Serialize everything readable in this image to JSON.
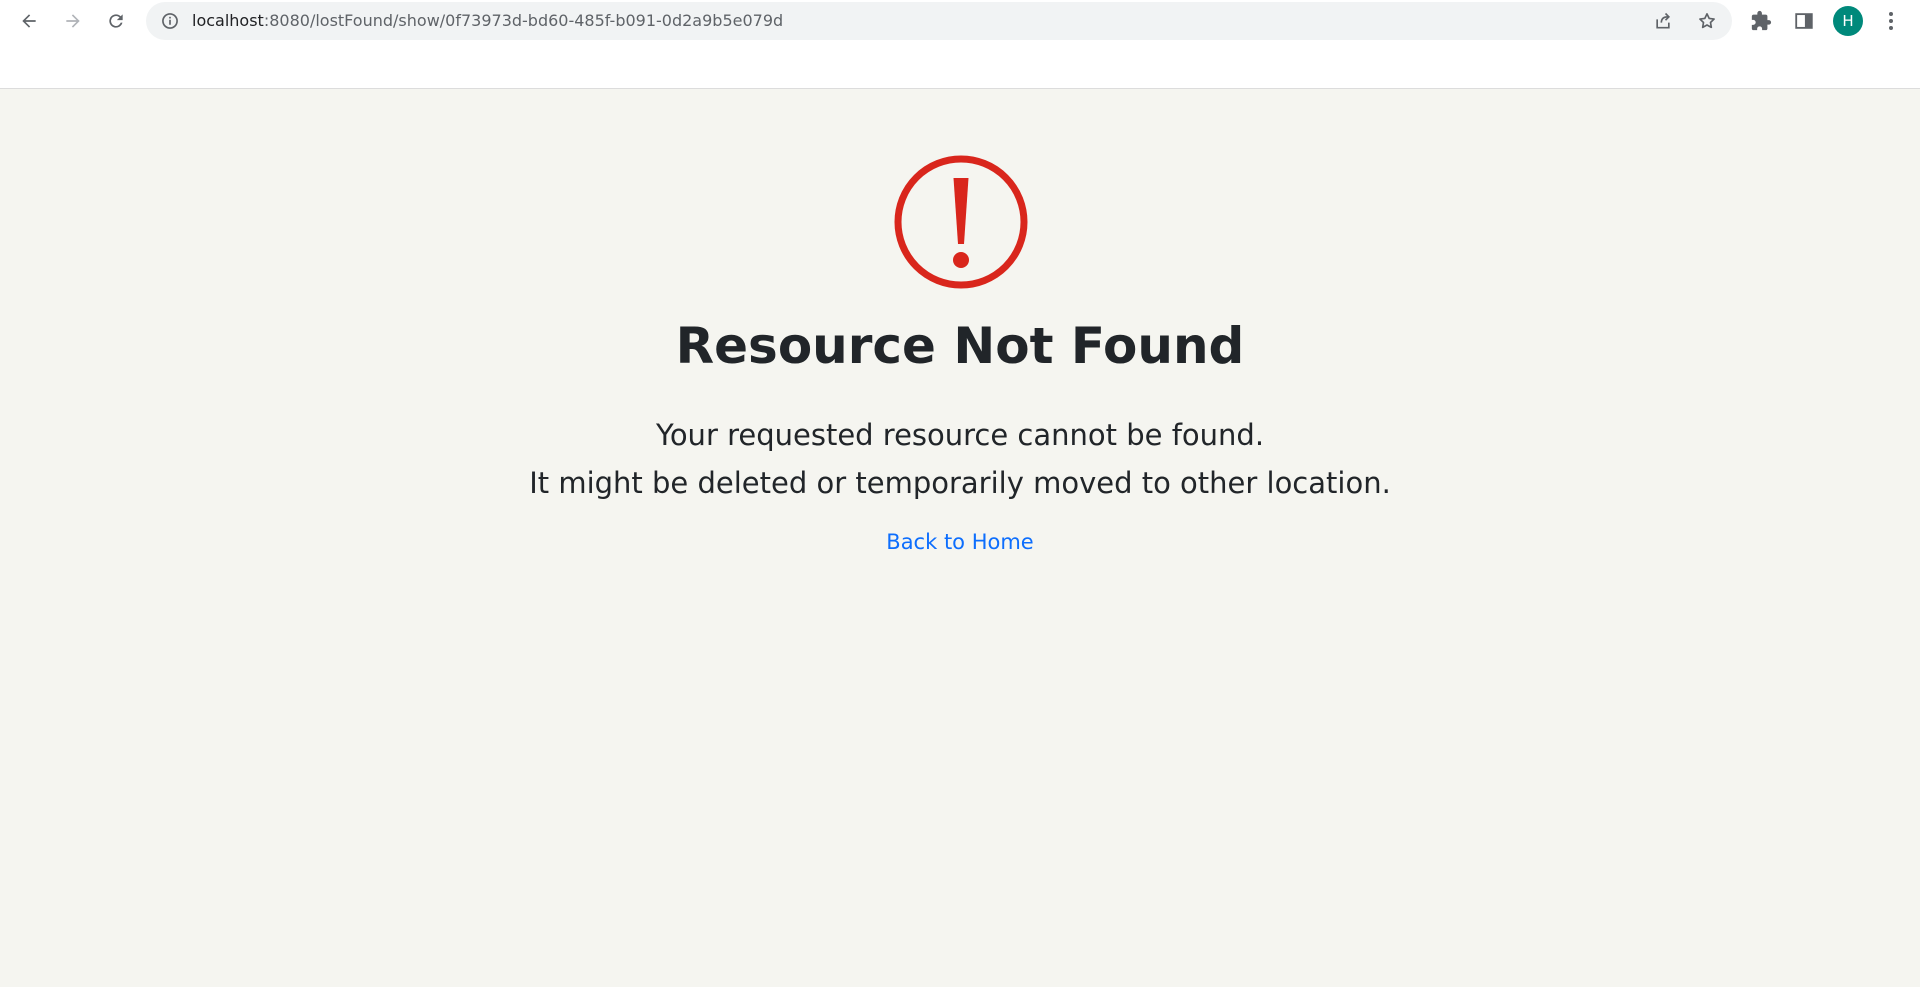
{
  "browser": {
    "url_host": "localhost",
    "url_rest": ":8080/lostFound/show/0f73973d-bd60-485f-b091-0d2a9b5e079d",
    "profile_initial": "H",
    "colors": {
      "avatar": "#00897b",
      "omnibox_bg": "#f1f3f4"
    },
    "icons": [
      "back-arrow-icon",
      "forward-arrow-icon",
      "reload-icon",
      "site-info-icon",
      "share-icon",
      "bookmark-star-icon",
      "extensions-puzzle-icon",
      "side-panel-icon",
      "more-vert-icon"
    ]
  },
  "error_page": {
    "icon": "exclamation-circle-icon",
    "title": "Resource Not Found",
    "message_line1": "Your requested resource cannot be found.",
    "message_line2": "It might be deleted or temporarily moved to other location.",
    "back_link": "Back to Home",
    "colors": {
      "icon": "#d9261c",
      "link": "#0d6efd",
      "text": "#212529",
      "background": "#f5f5f0"
    }
  }
}
